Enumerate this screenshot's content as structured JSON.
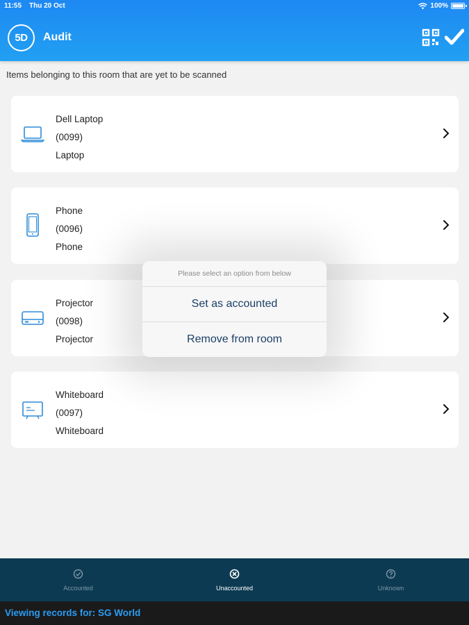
{
  "status": {
    "time": "11:55",
    "date": "Thu 20 Oct",
    "battery": "100%"
  },
  "header": {
    "logo_text": "5D",
    "title": "Audit"
  },
  "subtitle": "Items belonging to this room that are yet to be scanned",
  "items": [
    {
      "name": "Dell Laptop",
      "code": "(0099)",
      "type": "Laptop",
      "icon": "laptop-icon"
    },
    {
      "name": "Phone",
      "code": "(0096)",
      "type": "Phone",
      "icon": "phone-icon"
    },
    {
      "name": "Projector",
      "code": "(0098)",
      "type": "Projector",
      "icon": "projector-icon"
    },
    {
      "name": "Whiteboard",
      "code": "(0097)",
      "type": "Whiteboard",
      "icon": "whiteboard-icon"
    }
  ],
  "action_sheet": {
    "prompt": "Please select an option from below",
    "options": [
      "Set as accounted",
      "Remove from room"
    ]
  },
  "tabs": [
    {
      "label": "Accounted",
      "icon": "check-circle-icon",
      "active": false
    },
    {
      "label": "Unaccounted",
      "icon": "x-circle-icon",
      "active": true
    },
    {
      "label": "Unknown",
      "icon": "question-circle-icon",
      "active": false
    }
  ],
  "footer": {
    "text": "Viewing records for: SG World"
  },
  "colors": {
    "header": "#1e88f3",
    "tabbar": "#0c3a52",
    "footer_text": "#2a9df4",
    "icon_blue": "#2e8ad8"
  }
}
